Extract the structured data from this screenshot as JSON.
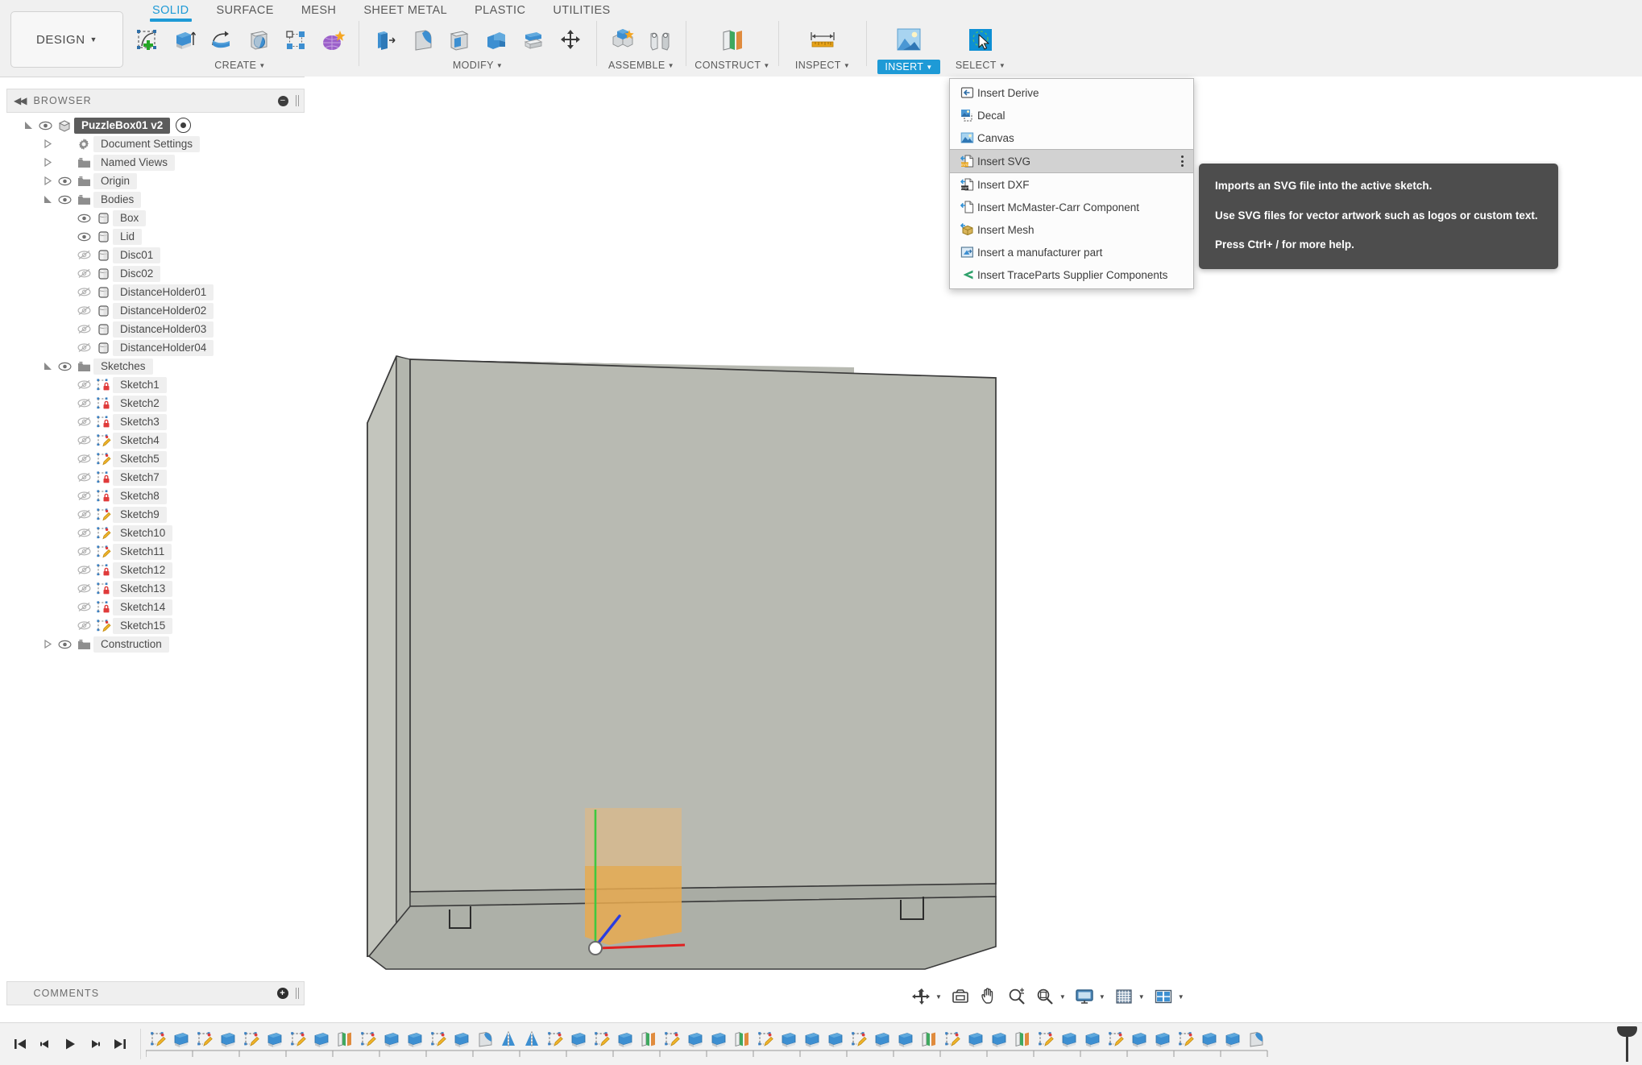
{
  "app": {
    "workspace_label": "DESIGN",
    "tabs": [
      {
        "label": "SOLID",
        "active": true
      },
      {
        "label": "SURFACE",
        "active": false
      },
      {
        "label": "MESH",
        "active": false
      },
      {
        "label": "SHEET METAL",
        "active": false
      },
      {
        "label": "PLASTIC",
        "active": false
      },
      {
        "label": "UTILITIES",
        "active": false
      }
    ],
    "ribbon_groups": [
      {
        "label": "CREATE",
        "highlight": false,
        "dropdown": true,
        "tools": [
          "create-sketch-icon",
          "extrude-icon",
          "revolve-icon",
          "hole-icon",
          "pattern-icon",
          "form-icon"
        ]
      },
      {
        "label": "MODIFY",
        "highlight": false,
        "dropdown": true,
        "tools": [
          "press-pull-icon",
          "fillet-icon",
          "shell-icon",
          "combine-icon",
          "split-face-icon",
          "move-copy-icon"
        ]
      },
      {
        "label": "ASSEMBLE",
        "highlight": false,
        "dropdown": true,
        "tools": [
          "new-component-icon",
          "joint-icon"
        ]
      },
      {
        "label": "CONSTRUCT",
        "highlight": false,
        "dropdown": true,
        "tools": [
          "offset-plane-icon"
        ]
      },
      {
        "label": "INSPECT",
        "highlight": false,
        "dropdown": true,
        "tools": [
          "measure-icon"
        ]
      },
      {
        "label": "INSERT",
        "highlight": true,
        "dropdown": true,
        "tools": [
          "insert-image-icon"
        ]
      },
      {
        "label": "SELECT",
        "highlight": false,
        "dropdown": true,
        "tools": [
          "select-cursor-icon"
        ]
      }
    ]
  },
  "browser": {
    "title": "BROWSER",
    "root": {
      "label": "PuzzleBox01 v2",
      "selected": true
    },
    "items": [
      {
        "label": "Document Settings",
        "indent": 1,
        "arrow": "collapsed",
        "eye": "none",
        "icon": "gear-icon"
      },
      {
        "label": "Named Views",
        "indent": 1,
        "arrow": "collapsed",
        "eye": "none",
        "icon": "folder-icon"
      },
      {
        "label": "Origin",
        "indent": 1,
        "arrow": "collapsed",
        "eye": "on",
        "icon": "folder-icon"
      },
      {
        "label": "Bodies",
        "indent": 1,
        "arrow": "expanded",
        "eye": "on",
        "icon": "folder-icon"
      },
      {
        "label": "Box",
        "indent": 2,
        "arrow": "none",
        "eye": "on",
        "icon": "body-icon"
      },
      {
        "label": "Lid",
        "indent": 2,
        "arrow": "none",
        "eye": "on",
        "icon": "body-icon"
      },
      {
        "label": "Disc01",
        "indent": 2,
        "arrow": "none",
        "eye": "off",
        "icon": "body-icon"
      },
      {
        "label": "Disc02",
        "indent": 2,
        "arrow": "none",
        "eye": "off",
        "icon": "body-icon"
      },
      {
        "label": "DistanceHolder01",
        "indent": 2,
        "arrow": "none",
        "eye": "off",
        "icon": "body-icon"
      },
      {
        "label": "DistanceHolder02",
        "indent": 2,
        "arrow": "none",
        "eye": "off",
        "icon": "body-icon"
      },
      {
        "label": "DistanceHolder03",
        "indent": 2,
        "arrow": "none",
        "eye": "off",
        "icon": "body-icon"
      },
      {
        "label": "DistanceHolder04",
        "indent": 2,
        "arrow": "none",
        "eye": "off",
        "icon": "body-icon"
      },
      {
        "label": "Sketches",
        "indent": 1,
        "arrow": "expanded",
        "eye": "on",
        "icon": "folder-icon"
      },
      {
        "label": "Sketch1",
        "indent": 2,
        "arrow": "none",
        "eye": "off",
        "icon": "sketch-locked-icon"
      },
      {
        "label": "Sketch2",
        "indent": 2,
        "arrow": "none",
        "eye": "off",
        "icon": "sketch-locked-icon"
      },
      {
        "label": "Sketch3",
        "indent": 2,
        "arrow": "none",
        "eye": "off",
        "icon": "sketch-locked-icon"
      },
      {
        "label": "Sketch4",
        "indent": 2,
        "arrow": "none",
        "eye": "off",
        "icon": "sketch-icon"
      },
      {
        "label": "Sketch5",
        "indent": 2,
        "arrow": "none",
        "eye": "off",
        "icon": "sketch-icon"
      },
      {
        "label": "Sketch7",
        "indent": 2,
        "arrow": "none",
        "eye": "off",
        "icon": "sketch-locked-icon"
      },
      {
        "label": "Sketch8",
        "indent": 2,
        "arrow": "none",
        "eye": "off",
        "icon": "sketch-locked-icon"
      },
      {
        "label": "Sketch9",
        "indent": 2,
        "arrow": "none",
        "eye": "off",
        "icon": "sketch-icon"
      },
      {
        "label": "Sketch10",
        "indent": 2,
        "arrow": "none",
        "eye": "off",
        "icon": "sketch-icon"
      },
      {
        "label": "Sketch11",
        "indent": 2,
        "arrow": "none",
        "eye": "off",
        "icon": "sketch-icon"
      },
      {
        "label": "Sketch12",
        "indent": 2,
        "arrow": "none",
        "eye": "off",
        "icon": "sketch-locked-icon"
      },
      {
        "label": "Sketch13",
        "indent": 2,
        "arrow": "none",
        "eye": "off",
        "icon": "sketch-locked-icon"
      },
      {
        "label": "Sketch14",
        "indent": 2,
        "arrow": "none",
        "eye": "off",
        "icon": "sketch-locked-icon"
      },
      {
        "label": "Sketch15",
        "indent": 2,
        "arrow": "none",
        "eye": "off",
        "icon": "sketch-icon"
      },
      {
        "label": "Construction",
        "indent": 1,
        "arrow": "collapsed",
        "eye": "on",
        "icon": "folder-icon"
      }
    ]
  },
  "insert_menu": {
    "items": [
      {
        "label": "Insert Derive",
        "icon": "derive-icon",
        "highlighted": false,
        "kebab": false
      },
      {
        "label": "Decal",
        "icon": "decal-icon",
        "highlighted": false,
        "kebab": false
      },
      {
        "label": "Canvas",
        "icon": "canvas-icon",
        "highlighted": false,
        "kebab": false
      },
      {
        "label": "Insert SVG",
        "icon": "svg-icon",
        "highlighted": true,
        "kebab": true
      },
      {
        "label": "Insert DXF",
        "icon": "dxf-icon",
        "highlighted": false,
        "kebab": false
      },
      {
        "label": "Insert McMaster-Carr Component",
        "icon": "mcmaster-icon",
        "highlighted": false,
        "kebab": false
      },
      {
        "label": "Insert Mesh",
        "icon": "mesh-icon",
        "highlighted": false,
        "kebab": false
      },
      {
        "label": "Insert a manufacturer part",
        "icon": "manufacturer-part-icon",
        "highlighted": false,
        "kebab": false
      },
      {
        "label": "Insert TraceParts Supplier Components",
        "icon": "traceparts-icon",
        "highlighted": false,
        "kebab": false
      }
    ]
  },
  "tooltip": {
    "line1": "Imports an SVG file into the active sketch.",
    "line2": "Use SVG files for vector artwork such as logos or custom text.",
    "line3": "Press Ctrl+ / for more help."
  },
  "view_toolbar": {
    "buttons": [
      {
        "name": "orbit-icon",
        "caret": true
      },
      {
        "name": "look-at-icon",
        "caret": false
      },
      {
        "name": "pan-icon",
        "caret": false
      },
      {
        "name": "zoom-icon",
        "caret": false
      },
      {
        "name": "fit-icon",
        "caret": true
      },
      {
        "name": "display-settings-icon",
        "caret": true
      },
      {
        "name": "grid-snaps-icon",
        "caret": true
      },
      {
        "name": "viewports-icon",
        "caret": true
      }
    ]
  },
  "comments": {
    "title": "COMMENTS"
  },
  "timeline": {
    "playback": [
      "skip-to-start-icon",
      "step-back-icon",
      "play-icon",
      "step-forward-icon",
      "skip-to-end-icon"
    ],
    "features": [
      "sketch-icon",
      "extrude-icon",
      "sketch-icon",
      "extrude-icon",
      "sketch-icon",
      "extrude-icon",
      "sketch-icon",
      "extrude-icon",
      "plane-icon",
      "sketch-icon",
      "extrude-icon",
      "extrude-icon",
      "sketch-icon",
      "extrude-icon",
      "fillet-icon",
      "mirror-icon",
      "mirror-icon",
      "sketch-icon",
      "extrude-icon",
      "sketch-icon",
      "extrude-icon",
      "plane-icon",
      "sketch-icon",
      "extrude-icon",
      "extrude-icon",
      "plane-icon",
      "sketch-icon",
      "extrude-icon",
      "extrude-icon",
      "extrude-icon",
      "sketch-icon",
      "extrude-icon",
      "extrude-icon",
      "plane-icon",
      "sketch-icon",
      "extrude-icon",
      "extrude-icon",
      "plane-icon",
      "sketch-icon",
      "extrude-icon",
      "extrude-icon",
      "sketch-icon",
      "extrude-icon",
      "extrude-icon",
      "sketch-icon",
      "extrude-icon",
      "extrude-icon",
      "fillet-icon"
    ]
  },
  "model": {
    "body_label": "PuzzleBox01 box body",
    "axis_colors": {
      "x": "#e02020",
      "y": "#3ec93e",
      "z": "#2a3de0"
    },
    "sketch_plane_color": "#e8b87a",
    "face_front": "#b8bab2",
    "face_side": "#c3c5bd",
    "face_bottom": "#a9aca4"
  }
}
